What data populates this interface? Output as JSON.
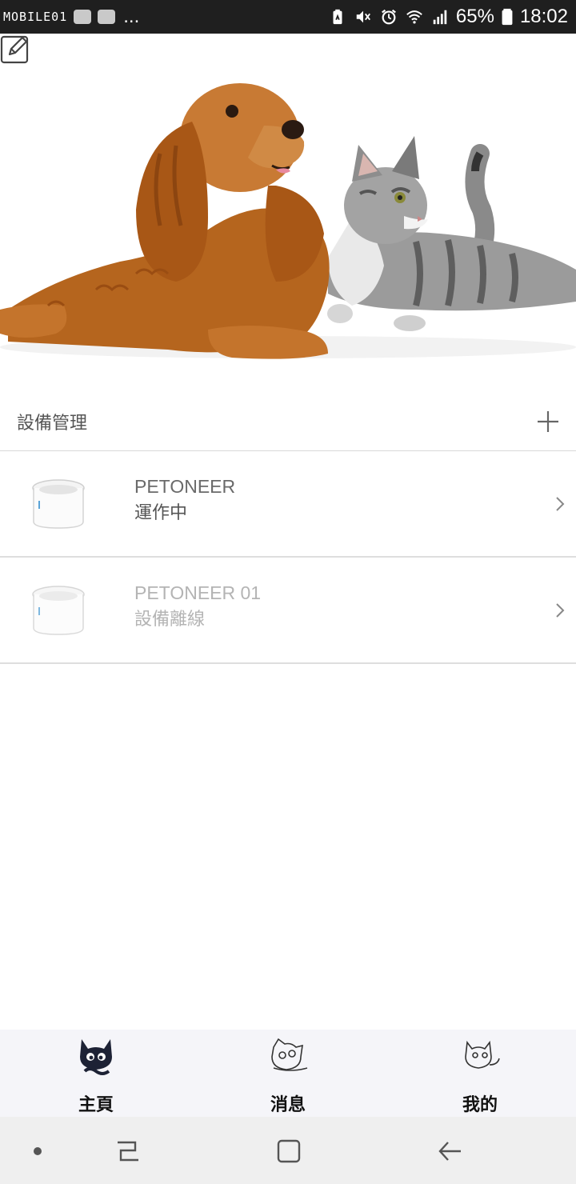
{
  "status_bar": {
    "watermark": "MOBILE01",
    "overflow": "...",
    "battery_percent": "65%",
    "time": "18:02",
    "icons": [
      "battery-saver-icon",
      "mute-icon",
      "alarm-icon",
      "wifi-icon",
      "signal-icon",
      "battery-icon"
    ]
  },
  "hero": {
    "image": "dog-and-cat-photo",
    "edit_icon": "edit-icon"
  },
  "section": {
    "title": "設備管理",
    "add_icon": "plus-icon"
  },
  "devices": [
    {
      "name": "PETONEER",
      "status": "運作中",
      "online": true
    },
    {
      "name": "PETONEER 01",
      "status": "設備離線",
      "online": false
    }
  ],
  "tabs": [
    {
      "label": "主頁",
      "icon": "cat-home-icon",
      "active": true
    },
    {
      "label": "消息",
      "icon": "cat-message-icon",
      "active": false
    },
    {
      "label": "我的",
      "icon": "cat-profile-icon",
      "active": false
    }
  ],
  "nav_bar": {
    "items": [
      "dot-icon",
      "recents-icon",
      "home-square-icon",
      "back-arrow-icon"
    ]
  },
  "colors": {
    "status_bar_bg": "#1f1f1f",
    "divider": "#dedede",
    "tab_bar_bg": "#f5f5f9",
    "nav_bar_bg": "#efefef",
    "offline_text": "#b4b4b4"
  }
}
